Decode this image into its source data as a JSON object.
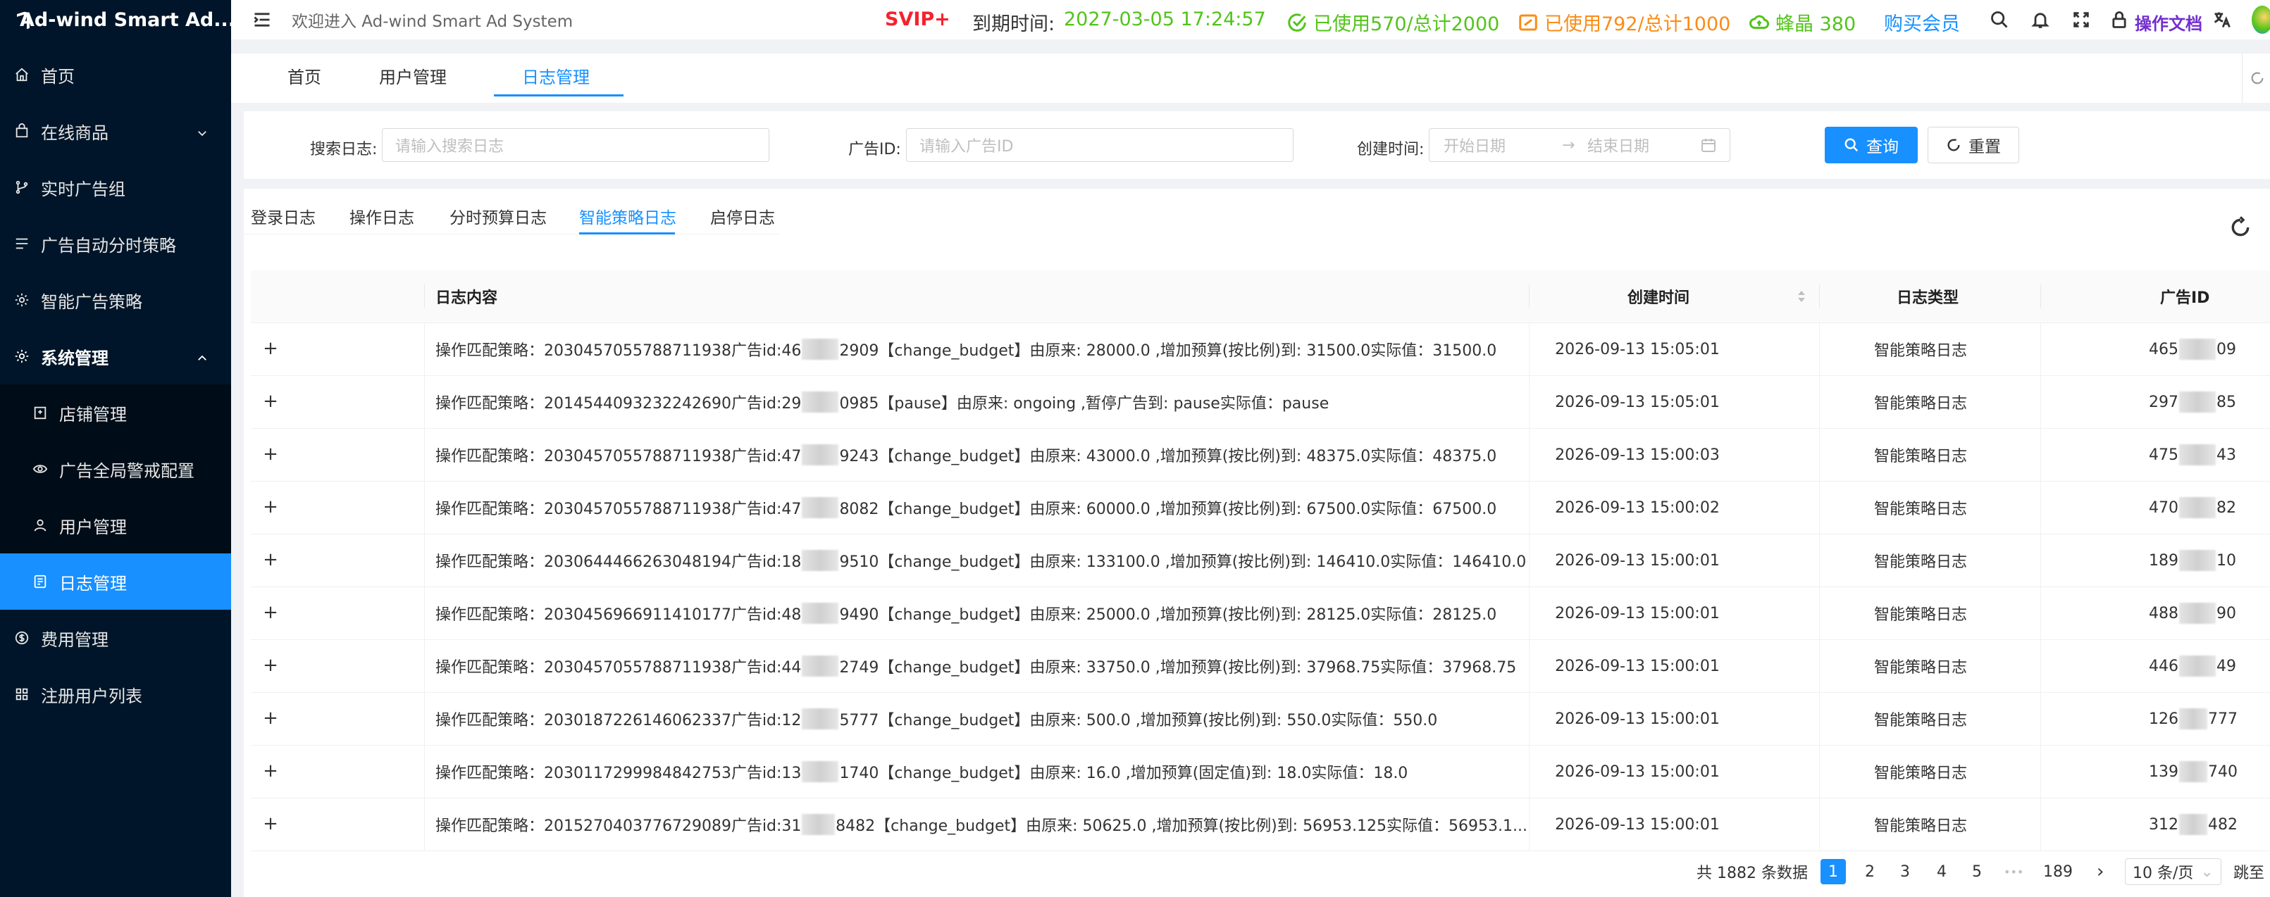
{
  "app": {
    "title": "Ad-wind Smart Ad..."
  },
  "sidebar": {
    "items": [
      {
        "label": "首页",
        "icon": "home-icon"
      },
      {
        "label": "在线商品",
        "icon": "bag-icon"
      },
      {
        "label": "实时广告组",
        "icon": "branch-icon"
      },
      {
        "label": "广告自动分时策略",
        "icon": "list-icon"
      },
      {
        "label": "智能广告策略",
        "icon": "gear-icon"
      },
      {
        "label": "系统管理",
        "icon": "gear-icon"
      },
      {
        "label": "店铺管理",
        "icon": "shop-icon"
      },
      {
        "label": "广告全局警戒配置",
        "icon": "eye-icon"
      },
      {
        "label": "用户管理",
        "icon": "user-icon"
      },
      {
        "label": "日志管理",
        "icon": "log-icon"
      },
      {
        "label": "费用管理",
        "icon": "dollar-icon"
      },
      {
        "label": "注册用户列表",
        "icon": "grid-icon"
      }
    ]
  },
  "header": {
    "welcome": "欢迎进入 Ad-wind Smart Ad System",
    "svip": "SVIP+",
    "expire_label": "到期时间:",
    "expire_value": "2027-03-05 17:24:57",
    "usage1": "已使用570/总计2000",
    "usage2": "已使用792/总计1000",
    "crystal": "蜂晶 380",
    "buy": "购买会员",
    "docs": "操作文档",
    "colors": {
      "svip": "#f5222d",
      "green": "#52c41a",
      "orange": "#fa8c16",
      "blue": "#1890ff",
      "purple": "#722ed1"
    }
  },
  "tags": [
    "首页",
    "用户管理",
    "日志管理"
  ],
  "search": {
    "log_label": "搜索日志:",
    "log_placeholder": "请输入搜索日志",
    "ad_label": "广告ID:",
    "ad_placeholder": "请输入广告ID",
    "time_label": "创建时间:",
    "start_placeholder": "开始日期",
    "end_placeholder": "结束日期",
    "query": "查询",
    "reset": "重置"
  },
  "log_tabs": [
    "登录日志",
    "操作日志",
    "分时预算日志",
    "智能策略日志",
    "启停日志"
  ],
  "table": {
    "headers": {
      "content": "日志内容",
      "time": "创建时间",
      "type": "日志类型",
      "ad": "广告ID"
    },
    "rows": [
      {
        "pre": "操作匹配策略：2030457055788711938广告id:46",
        "post": "2909【change_budget】由原来: 28000.0 ,增加预算(按比例)到: 31500.0实际值：31500.0",
        "time": "2026-09-13 15:05:01",
        "type": "智能策略日志",
        "ad_a": "465",
        "ad_b": "09"
      },
      {
        "pre": "操作匹配策略：2014544093232242690广告id:29",
        "post": "0985【pause】由原来: ongoing ,暂停广告到: pause实际值：pause",
        "time": "2026-09-13 15:05:01",
        "type": "智能策略日志",
        "ad_a": "297",
        "ad_b": "85"
      },
      {
        "pre": "操作匹配策略：2030457055788711938广告id:47",
        "post": "9243【change_budget】由原来: 43000.0 ,增加预算(按比例)到: 48375.0实际值：48375.0",
        "time": "2026-09-13 15:00:03",
        "type": "智能策略日志",
        "ad_a": "475",
        "ad_b": "43"
      },
      {
        "pre": "操作匹配策略：2030457055788711938广告id:47",
        "post": "8082【change_budget】由原来: 60000.0 ,增加预算(按比例)到: 67500.0实际值：67500.0",
        "time": "2026-09-13 15:00:02",
        "type": "智能策略日志",
        "ad_a": "470",
        "ad_b": "82"
      },
      {
        "pre": "操作匹配策略：2030644466263048194广告id:18",
        "post": "9510【change_budget】由原来: 133100.0 ,增加预算(按比例)到: 146410.0实际值：146410.0",
        "time": "2026-09-13 15:00:01",
        "type": "智能策略日志",
        "ad_a": "189",
        "ad_b": "10"
      },
      {
        "pre": "操作匹配策略：2030456966911410177广告id:48",
        "post": "9490【change_budget】由原来: 25000.0 ,增加预算(按比例)到: 28125.0实际值：28125.0",
        "time": "2026-09-13 15:00:01",
        "type": "智能策略日志",
        "ad_a": "488",
        "ad_b": "90"
      },
      {
        "pre": "操作匹配策略：2030457055788711938广告id:44",
        "post": "2749【change_budget】由原来: 33750.0 ,增加预算(按比例)到: 37968.75实际值：37968.75",
        "time": "2026-09-13 15:00:01",
        "type": "智能策略日志",
        "ad_a": "446",
        "ad_b": "49"
      },
      {
        "pre": "操作匹配策略：2030187226146062337广告id:12",
        "post": "5777【change_budget】由原来: 500.0 ,增加预算(按比例)到: 550.0实际值：550.0",
        "time": "2026-09-13 15:00:01",
        "type": "智能策略日志",
        "ad_a": "126",
        "ad_b": "777"
      },
      {
        "pre": "操作匹配策略：2030117299984842753广告id:13",
        "post": "1740【change_budget】由原来: 16.0 ,增加预算(固定值)到: 18.0实际值：18.0",
        "time": "2026-09-13 15:00:01",
        "type": "智能策略日志",
        "ad_a": "139",
        "ad_b": "740"
      },
      {
        "pre": "操作匹配策略：2015270403776729089广告id:31",
        "post": "8482【change_budget】由原来: 50625.0 ,增加预算(按比例)到: 56953.125实际值：56953.1...",
        "time": "2026-09-13 15:00:01",
        "type": "智能策略日志",
        "ad_a": "312",
        "ad_b": "482"
      }
    ]
  },
  "pagination": {
    "total": "共 1882 条数据",
    "pages": [
      "1",
      "2",
      "3",
      "4",
      "5"
    ],
    "ellipsis": "•••",
    "last": "189",
    "page_size": "10 条/页",
    "goto": "跳至",
    "current": "1"
  }
}
